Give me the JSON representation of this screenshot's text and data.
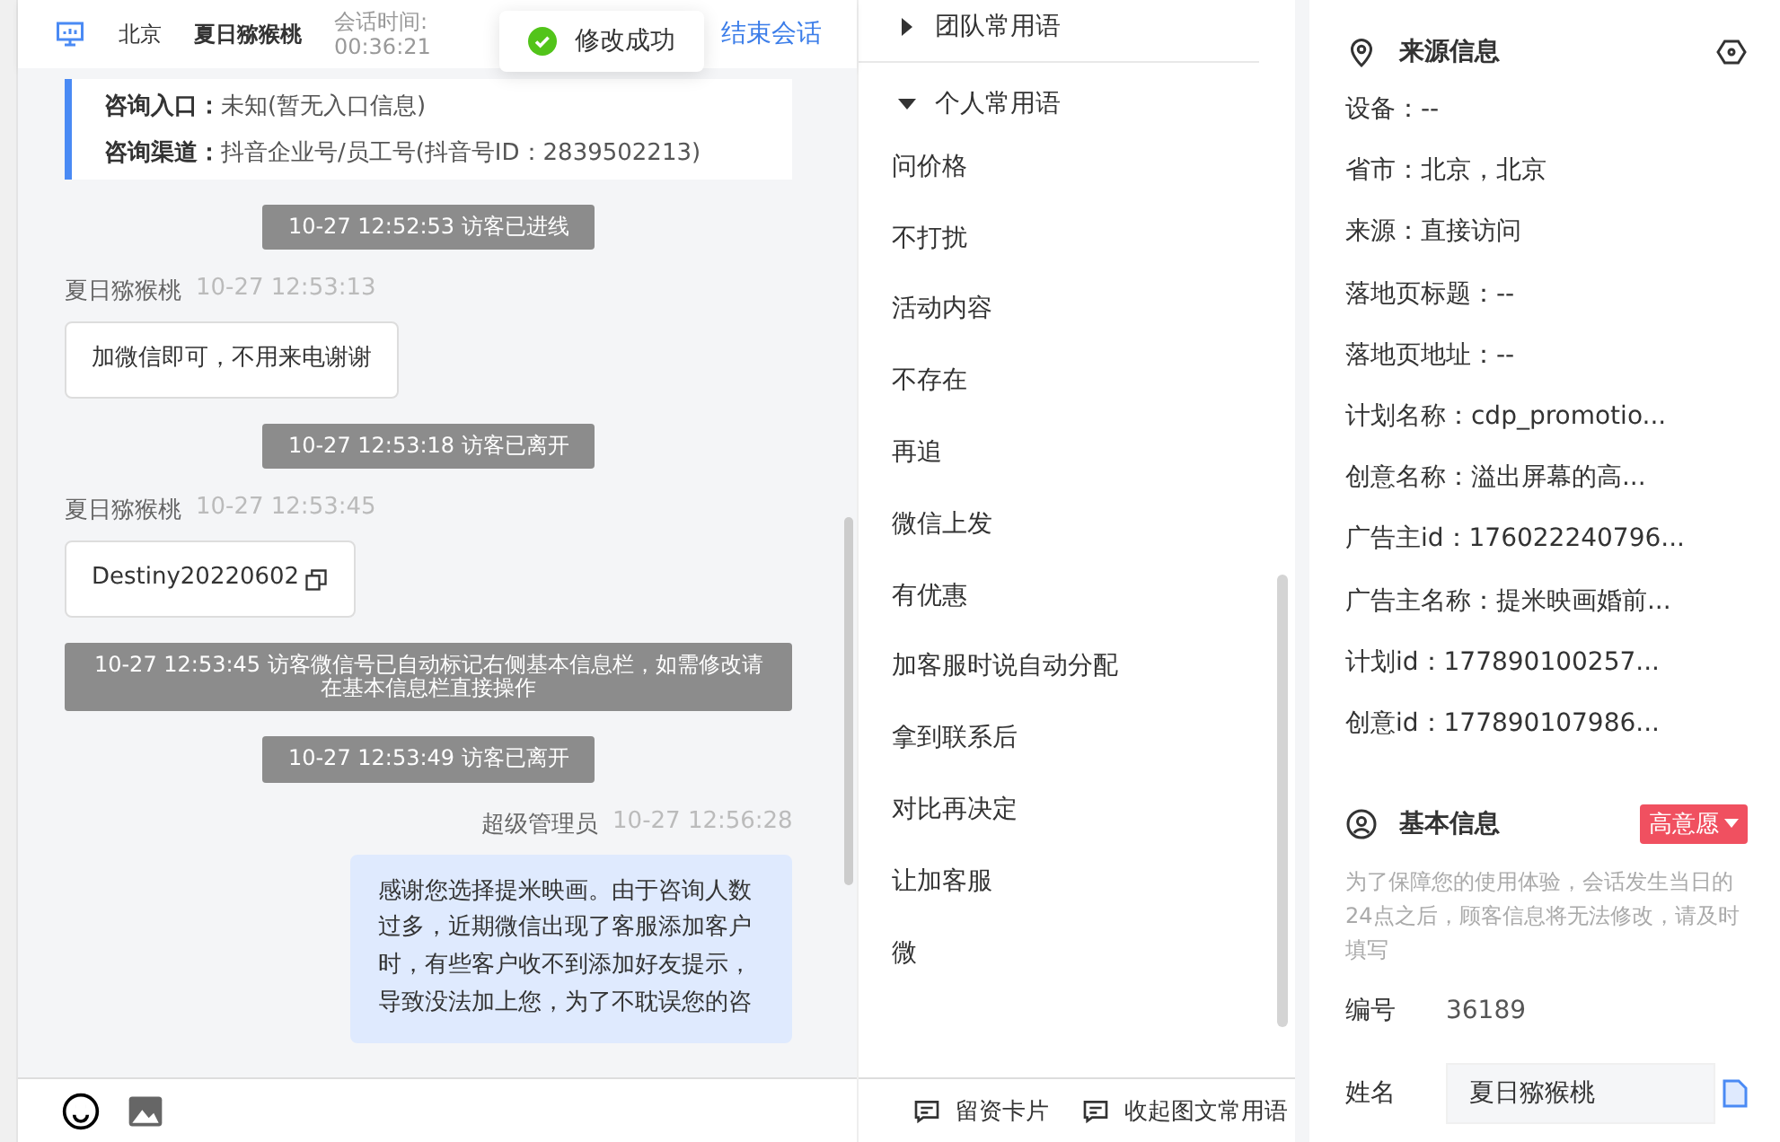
{
  "header": {
    "location": "北京",
    "visitor_name": "夏日猕猴桃",
    "session_label": "会话时间:",
    "session_time": "00:36:21",
    "end_button": "结束会话"
  },
  "toast": {
    "text": "修改成功"
  },
  "entry_card": [
    {
      "label": "咨询入口：",
      "value": "未知(暂无入口信息)"
    },
    {
      "label": "咨询渠道：",
      "value": "抖音企业号/员工号(抖音号ID：2839502213)"
    }
  ],
  "messages": [
    {
      "kind": "system",
      "text": "10-27 12:52:53 访客已进线"
    },
    {
      "kind": "visitor",
      "sender": "夏日猕猴桃",
      "time": "10-27 12:53:13",
      "text": "加微信即可，不用来电谢谢",
      "copyable": false
    },
    {
      "kind": "system",
      "text": "10-27 12:53:18 访客已离开"
    },
    {
      "kind": "visitor",
      "sender": "夏日猕猴桃",
      "time": "10-27 12:53:45",
      "text": "Destiny20220602",
      "copyable": true
    },
    {
      "kind": "system",
      "text": "10-27 12:53:45 访客微信号已自动标记右侧基本信息栏，如需修改请在基本信息栏直接操作"
    },
    {
      "kind": "system",
      "text": "10-27 12:53:49 访客已离开"
    },
    {
      "kind": "agent",
      "sender": "超级管理员",
      "time": "10-27 12:56:28",
      "text": "感谢您选择提米映画。由于咨询人数过多，近期微信出现了客服添加客户时，有些客户收不到添加好友提示，导致没法加上您，为了不耽误您的咨"
    }
  ],
  "phrase_groups": [
    {
      "label": "团队常用语",
      "expanded": false
    },
    {
      "label": "个人常用语",
      "expanded": true,
      "items": [
        "问价格",
        "不打扰",
        "活动内容",
        "不存在",
        "再追",
        "微信上发",
        "有优惠",
        "加客服时说自动分配",
        "拿到联系后",
        "对比再决定",
        "让加客服",
        "微"
      ]
    }
  ],
  "footer_actions": [
    "留资卡片",
    "收起图文常用语"
  ],
  "source_info": {
    "title": "来源信息",
    "rows": [
      "设备：--",
      "省市：北京，北京",
      "来源：直接访问",
      "落地页标题：--",
      "落地页地址：--",
      "计划名称：cdp_promotio...",
      "创意名称：溢出屏幕的高...",
      "广告主id：176022240796...",
      "广告主名称：提米映画婚前...",
      "计划id：177890100257...",
      "创意id：177890107986..."
    ]
  },
  "basic_info": {
    "title": "基本信息",
    "intent_tag": "高意愿",
    "notice": "为了保障您的使用体验，会话发生当日的24点之后，顾客信息将无法修改，请及时填写",
    "fields": [
      {
        "kind": "text",
        "label": "编号",
        "value": "36189"
      },
      {
        "kind": "input",
        "label": "姓名",
        "value": "夏日猕猴桃"
      }
    ]
  }
}
